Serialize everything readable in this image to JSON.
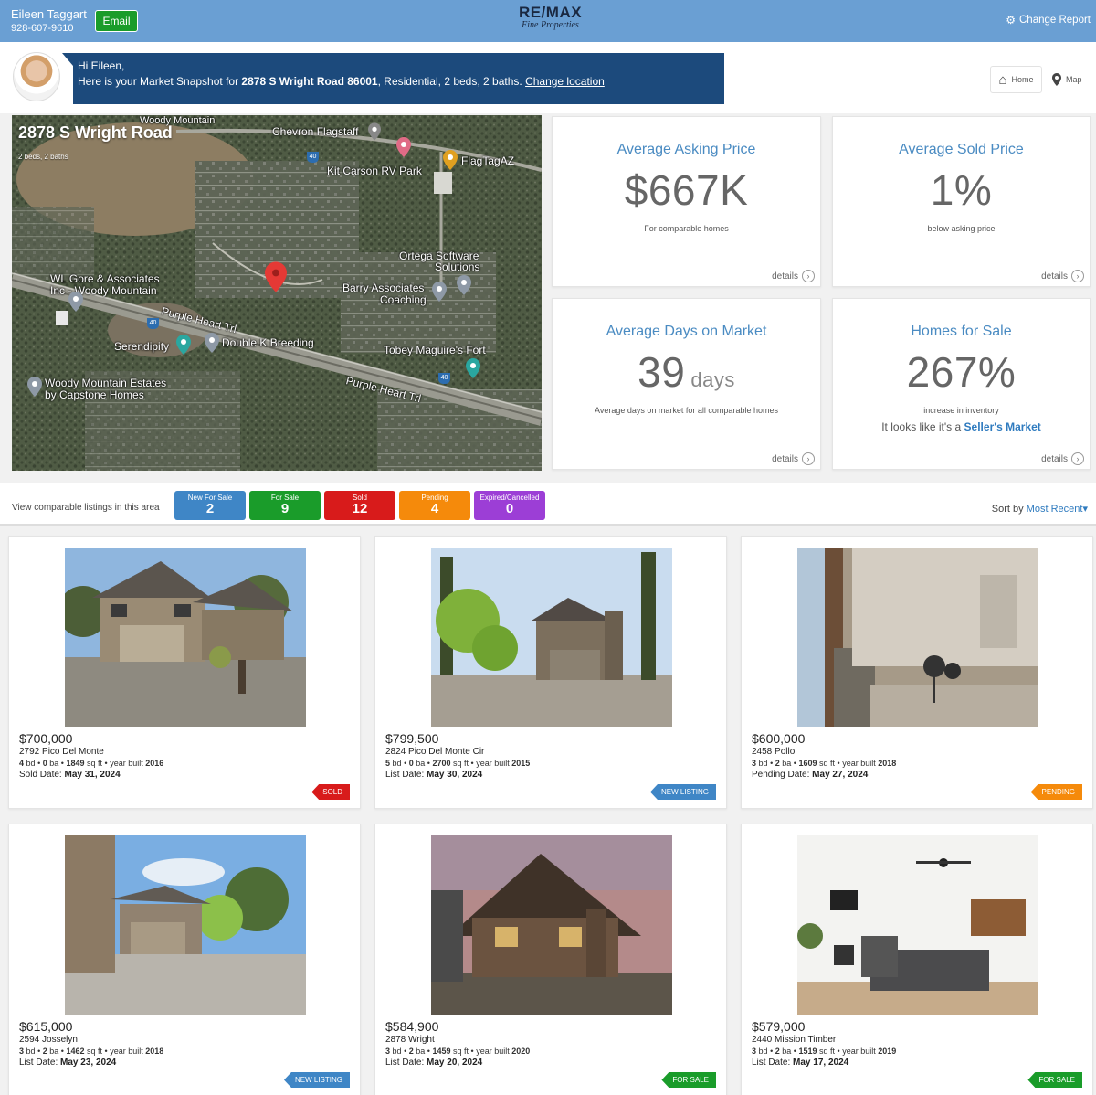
{
  "header": {
    "agent_name": "Eileen Taggart",
    "agent_phone": "928-607-9610",
    "email_label": "Email",
    "logo_main": "RE/MAX",
    "logo_sub": "Fine Properties",
    "change_report_label": "Change Report"
  },
  "greeting": {
    "hello": "Hi Eileen,",
    "line_prefix": "Here is your Market Snapshot for",
    "address": "2878 S Wright Road 86001",
    "line_suffix": ", Residential, 2 beds, 2 baths.",
    "change_location": "Change location",
    "nav_home": "Home",
    "nav_map": "Map"
  },
  "map": {
    "title": "2878 S Wright Road",
    "subtitle": "2 beds, 2 baths",
    "labels": {
      "woody": "Woody Mountain",
      "chevron": "Chevron Flagstaff",
      "kit_carson": "Kit Carson RV Park",
      "flagtag": "FlagTagAZ",
      "ortega1": "Ortega Software",
      "ortega2": "Solutions",
      "wlgore1": "WL Gore & Associates",
      "wlgore2": "Inc - Woody Mountain",
      "barry1": "Barry Associates",
      "barry2": "Coaching",
      "purple1": "Purple Heart Trl",
      "purple2": "Purple Heart Trl",
      "serendipity": "Serendipity",
      "double_k": "Double K Breeding",
      "tobey": "Tobey Maguire's Fort",
      "wme1": "Woody Mountain Estates",
      "wme2": "by Capstone Homes",
      "i40a": "40",
      "i40b": "40",
      "i40c": "40"
    }
  },
  "stats": {
    "asking": {
      "title": "Average Asking Price",
      "value": "$667K",
      "note": "For comparable homes",
      "details": "details"
    },
    "sold": {
      "title": "Average Sold Price",
      "value": "1%",
      "note": "below asking price",
      "details": "details"
    },
    "days": {
      "title": "Average Days on Market",
      "value": "39",
      "unit": "days",
      "note": "Average days on market for all comparable homes",
      "details": "details"
    },
    "homes": {
      "title": "Homes for Sale",
      "value": "267%",
      "note": "increase in inventory",
      "extra_prefix": "It looks like it's a",
      "extra_strong": "Seller's Market",
      "details": "details"
    }
  },
  "filters": {
    "label": "View comparable listings in this area",
    "pills": [
      {
        "label": "New For Sale",
        "count": "2",
        "color": "#3f86c6"
      },
      {
        "label": "For Sale",
        "count": "9",
        "color": "#1a9c2a"
      },
      {
        "label": "Sold",
        "count": "12",
        "color": "#d81b1b"
      },
      {
        "label": "Pending",
        "count": "4",
        "color": "#f58a0b"
      },
      {
        "label": "Expired/Cancelled",
        "count": "0",
        "color": "#9c3ed6"
      }
    ],
    "sort_label": "Sort by",
    "sort_value": "Most Recent▾"
  },
  "listings": [
    {
      "price": "$700,000",
      "address": "2792 Pico Del Monte",
      "bd": "4",
      "ba": "0",
      "sqft": "1849",
      "year": "2016",
      "date_label": "Sold Date:",
      "date": "May 31, 2024",
      "badge": "SOLD",
      "badge_color": "#d81b1b"
    },
    {
      "price": "$799,500",
      "address": "2824 Pico Del Monte Cir",
      "bd": "5",
      "ba": "0",
      "sqft": "2700",
      "year": "2015",
      "date_label": "List Date:",
      "date": "May 30, 2024",
      "badge": "NEW LISTING",
      "badge_color": "#3f86c6"
    },
    {
      "price": "$600,000",
      "address": "2458 Pollo",
      "bd": "3",
      "ba": "2",
      "sqft": "1609",
      "year": "2018",
      "date_label": "Pending Date:",
      "date": "May 27, 2024",
      "badge": "PENDING",
      "badge_color": "#f58a0b"
    },
    {
      "price": "$615,000",
      "address": "2594 Josselyn",
      "bd": "3",
      "ba": "2",
      "sqft": "1462",
      "year": "2018",
      "date_label": "List Date:",
      "date": "May 23, 2024",
      "badge": "NEW LISTING",
      "badge_color": "#3f86c6"
    },
    {
      "price": "$584,900",
      "address": "2878 Wright",
      "bd": "3",
      "ba": "2",
      "sqft": "1459",
      "year": "2020",
      "date_label": "List Date:",
      "date": "May 20, 2024",
      "badge": "FOR SALE",
      "badge_color": "#1a9c2a"
    },
    {
      "price": "$579,000",
      "address": "2440 Mission Timber",
      "bd": "3",
      "ba": "2",
      "sqft": "1519",
      "year": "2019",
      "date_label": "List Date:",
      "date": "May 17, 2024",
      "badge": "FOR SALE",
      "badge_color": "#1a9c2a"
    }
  ],
  "spec_units": {
    "bd": "bd",
    "ba": "ba",
    "sqft": "sq ft",
    "year": "year built",
    "sep": "•"
  },
  "colors": {
    "header": "#6a9fd3",
    "bubble": "#1c4a7c",
    "accent": "#4a8bc2",
    "map_pin": "#e53935"
  }
}
